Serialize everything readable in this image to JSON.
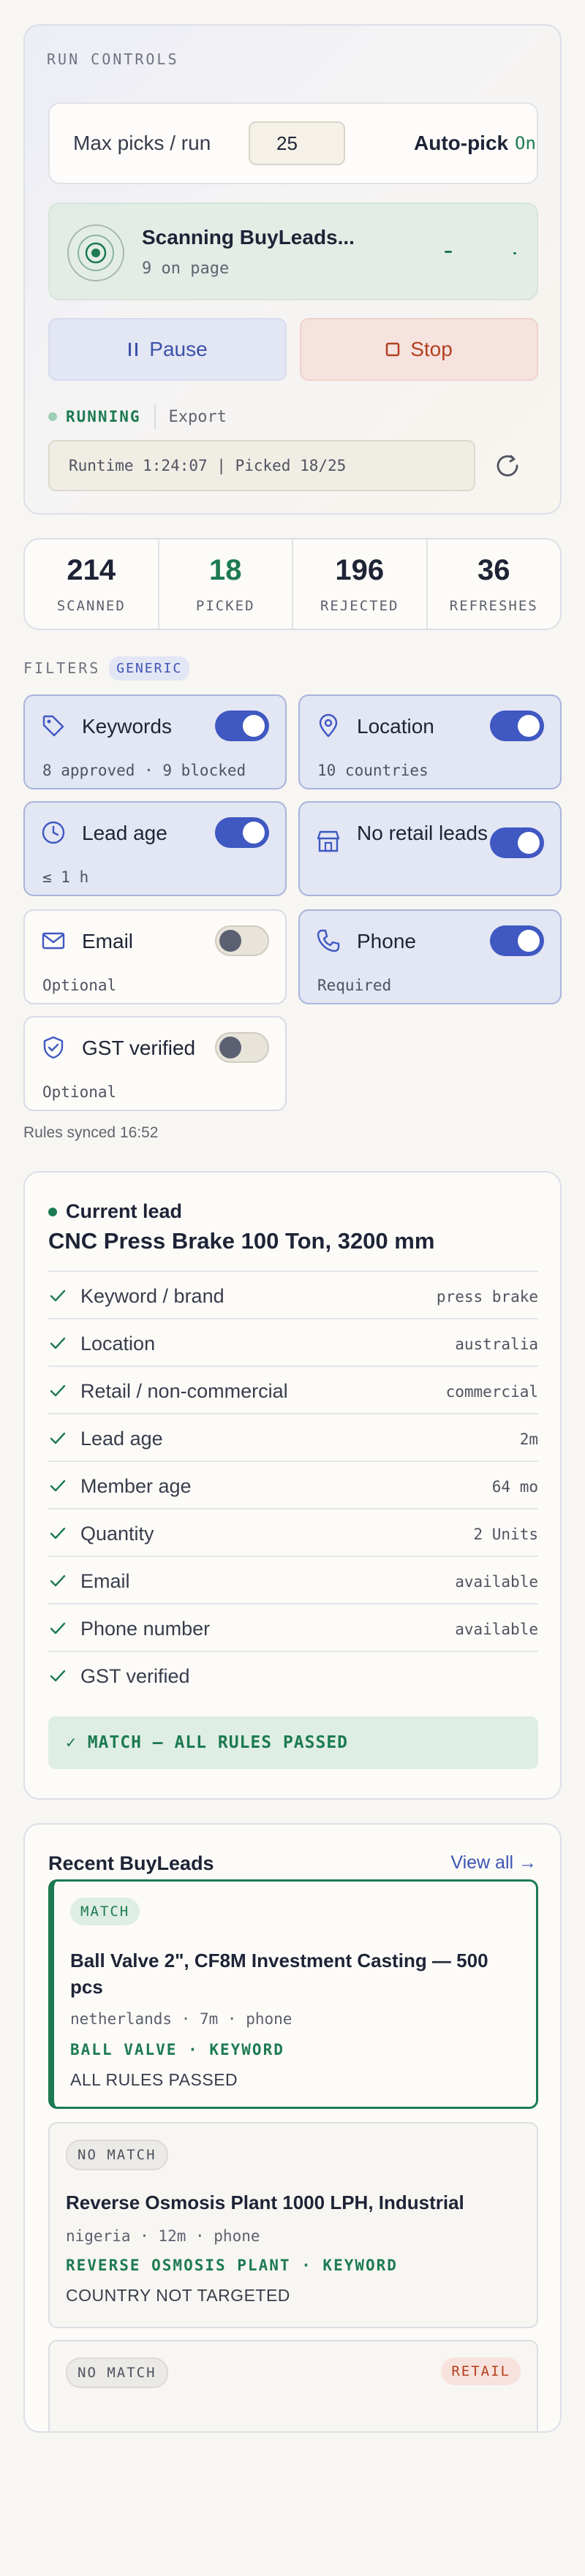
{
  "run_controls": {
    "section_label": "RUN CONTROLS",
    "max_picks_label": "Max picks / run",
    "max_picks_value": "25",
    "autopick_label": "Auto-pick",
    "autopick_state": "On",
    "scan_title": "Scanning BuyLeads...",
    "scan_sub": "9 on page",
    "pause_label": "Pause",
    "stop_label": "Stop",
    "status": "RUNNING",
    "export_label": "Export",
    "runtime": "Runtime 1:24:07 | Picked 18/25"
  },
  "stats": [
    {
      "value": "214",
      "label": "SCANNED",
      "color": "#1e2436"
    },
    {
      "value": "18",
      "label": "PICKED",
      "color": "#1d7a52"
    },
    {
      "value": "196",
      "label": "REJECTED",
      "color": "#1e2436"
    },
    {
      "value": "36",
      "label": "REFRESHES",
      "color": "#1e2436"
    }
  ],
  "filters": {
    "label": "FILTERS",
    "badge": "GENERIC",
    "items": [
      {
        "name": "Keywords",
        "sub": "8 approved · 9 blocked",
        "on": true,
        "icon": "tag-icon"
      },
      {
        "name": "Location",
        "sub": "10 countries",
        "on": true,
        "icon": "map-pin-icon"
      },
      {
        "name": "Lead age",
        "sub": "≤ 1 h",
        "on": true,
        "icon": "clock-icon"
      },
      {
        "name": "No retail leads",
        "sub": "",
        "on": true,
        "icon": "store-icon"
      },
      {
        "name": "Email",
        "sub": "Optional",
        "on": false,
        "icon": "mail-icon"
      },
      {
        "name": "Phone",
        "sub": "Required",
        "on": true,
        "icon": "phone-icon"
      },
      {
        "name": "GST verified",
        "sub": "Optional",
        "on": false,
        "icon": "shield-check-icon"
      }
    ],
    "synced": "Rules synced 16:52"
  },
  "current_lead": {
    "heading": "Current lead",
    "title": "CNC Press Brake 100 Ton, 3200 mm",
    "checks": [
      {
        "label": "Keyword / brand",
        "value": "press brake"
      },
      {
        "label": "Location",
        "value": "australia"
      },
      {
        "label": "Retail / non-commercial",
        "value": "commercial"
      },
      {
        "label": "Lead age",
        "value": "2m"
      },
      {
        "label": "Member age",
        "value": "64 mo"
      },
      {
        "label": "Quantity",
        "value": "2 Units"
      },
      {
        "label": "Email",
        "value": "available"
      },
      {
        "label": "Phone number",
        "value": "available"
      },
      {
        "label": "GST verified",
        "value": ""
      }
    ],
    "result": "✓ MATCH — ALL RULES PASSED"
  },
  "recent": {
    "title": "Recent BuyLeads",
    "view_all": "View all →",
    "items": [
      {
        "badge": "MATCH",
        "title": "Ball Valve 2\", CF8M Investment Casting — 500 pcs",
        "meta": "netherlands · 7m · phone",
        "keyword": "BALL VALVE · KEYWORD",
        "reason": "ALL RULES PASSED"
      },
      {
        "badge": "NO MATCH",
        "title": "Reverse Osmosis Plant 1000 LPH, Industrial",
        "meta": "nigeria · 12m · phone",
        "keyword": "REVERSE OSMOSIS PLANT · KEYWORD",
        "reason": "COUNTRY NOT TARGETED"
      },
      {
        "badge": "NO MATCH",
        "tag": "RETAIL"
      }
    ]
  },
  "colors": {
    "accent": "#3f58c2",
    "success": "#1d7a52",
    "danger": "#b3401f"
  }
}
